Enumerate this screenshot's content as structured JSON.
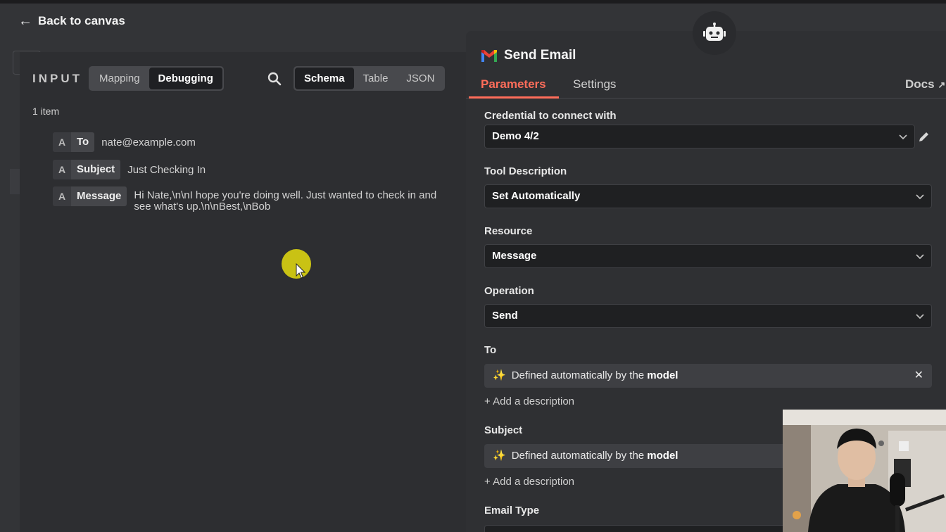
{
  "back": {
    "label": "Back to canvas"
  },
  "input": {
    "title": "INPUT",
    "modes": [
      "Mapping",
      "Debugging"
    ],
    "views": [
      "Schema",
      "Table",
      "JSON"
    ],
    "item_count": "1 item",
    "fields": [
      {
        "type": "A",
        "key": "To",
        "value": "nate@example.com"
      },
      {
        "type": "A",
        "key": "Subject",
        "value": "Just Checking In"
      },
      {
        "type": "A",
        "key": "Message",
        "value": "Hi Nate,\\n\\nI hope you're doing well. Just wanted to check in and see what's up.\\n\\nBest,\\nBob"
      }
    ]
  },
  "node": {
    "title": "Send Email",
    "tabs": [
      "Parameters",
      "Settings"
    ],
    "docs": "Docs",
    "credential_label": "Credential to connect with",
    "credential_value": "Demo 4/2",
    "tool_desc_label": "Tool Description",
    "tool_desc_value": "Set Automatically",
    "resource_label": "Resource",
    "resource_value": "Message",
    "operation_label": "Operation",
    "operation_value": "Send",
    "to_label": "To",
    "subject_label": "Subject",
    "email_type_label": "Email Type",
    "auto_prefix": "Defined automatically by the",
    "auto_model": "model",
    "add_description": "+ Add a description"
  },
  "colors": {
    "accent": "#ff6d5a",
    "highlight": "#c9c214"
  },
  "icons": {
    "back": "arrow-left-icon",
    "search": "search-icon",
    "robot": "robot-icon",
    "gmail": "gmail-icon",
    "edit": "pencil-icon",
    "chevron": "chevron-down-icon",
    "sparkle": "sparkle-icon",
    "close": "close-icon",
    "external": "external-link-icon"
  }
}
